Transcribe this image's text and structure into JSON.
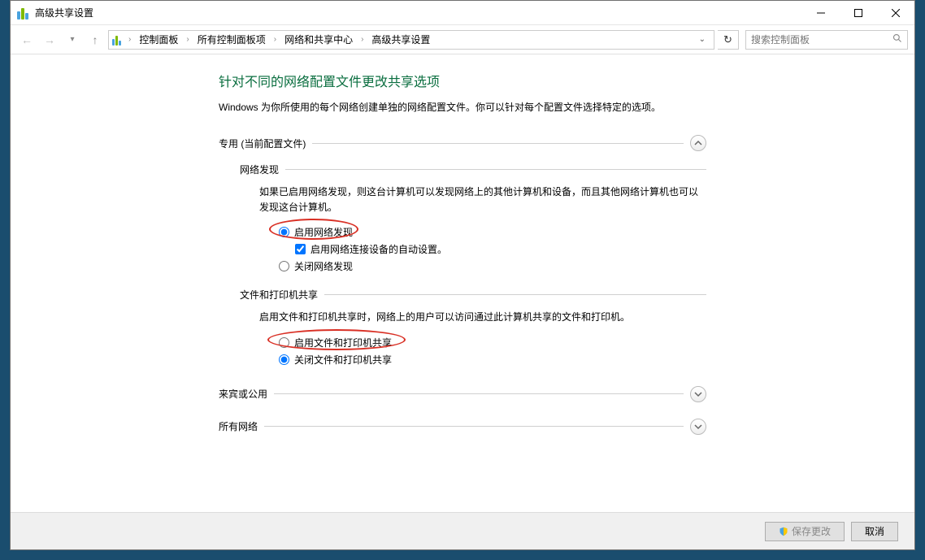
{
  "window": {
    "title": "高级共享设置"
  },
  "breadcrumb": {
    "items": [
      "控制面板",
      "所有控制面板项",
      "网络和共享中心",
      "高级共享设置"
    ]
  },
  "search": {
    "placeholder": "搜索控制面板"
  },
  "page": {
    "title": "针对不同的网络配置文件更改共享选项",
    "desc": "Windows 为你所使用的每个网络创建单独的网络配置文件。你可以针对每个配置文件选择特定的选项。"
  },
  "profiles": {
    "private": {
      "label": "专用 (当前配置文件)",
      "network_discovery": {
        "title": "网络发现",
        "desc": "如果已启用网络发现，则这台计算机可以发现网络上的其他计算机和设备，而且其他网络计算机也可以发现这台计算机。",
        "enable_label": "启用网络发现",
        "auto_setup_label": "启用网络连接设备的自动设置。",
        "disable_label": "关闭网络发现"
      },
      "file_printer_sharing": {
        "title": "文件和打印机共享",
        "desc": "启用文件和打印机共享时，网络上的用户可以访问通过此计算机共享的文件和打印机。",
        "enable_label": "启用文件和打印机共享",
        "disable_label": "关闭文件和打印机共享"
      }
    },
    "guest": {
      "label": "来宾或公用"
    },
    "all": {
      "label": "所有网络"
    }
  },
  "footer": {
    "save_label": "保存更改",
    "cancel_label": "取消"
  }
}
